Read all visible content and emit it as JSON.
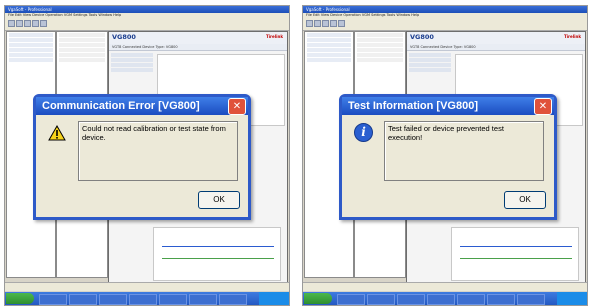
{
  "left": {
    "window_title": "VgaSoft - Professional",
    "menu": "File  Edit  View  Device Operation  VGM Settings  Tools  Window  Help",
    "panel_title": "VG800",
    "brand": "Tirelink",
    "strip": "VGT8 Connected   Device Type: VG800",
    "dialog": {
      "title": "Communication Error [VG800]",
      "message": "Could not read calibration or test state from device.",
      "ok": "OK",
      "close": "✕"
    }
  },
  "right": {
    "window_title": "VgaSoft - Professional",
    "menu": "File  Edit  View  Device Operation  VGM Settings  Tools  Window  Help",
    "panel_title": "VG800",
    "brand": "Tirelink",
    "strip": "VGT8 Connected   Device Type: VG800",
    "dialog": {
      "title": "Test Information [VG800]",
      "message": "Test failed or device prevented test execution!",
      "ok": "OK",
      "close": "✕"
    }
  },
  "colors": {
    "titlebar": "#1b4cc0",
    "close": "#e0523a",
    "taskbar": "#2459c2"
  },
  "icons": {
    "left_dialog": "warning-icon",
    "right_dialog": "info-icon"
  }
}
